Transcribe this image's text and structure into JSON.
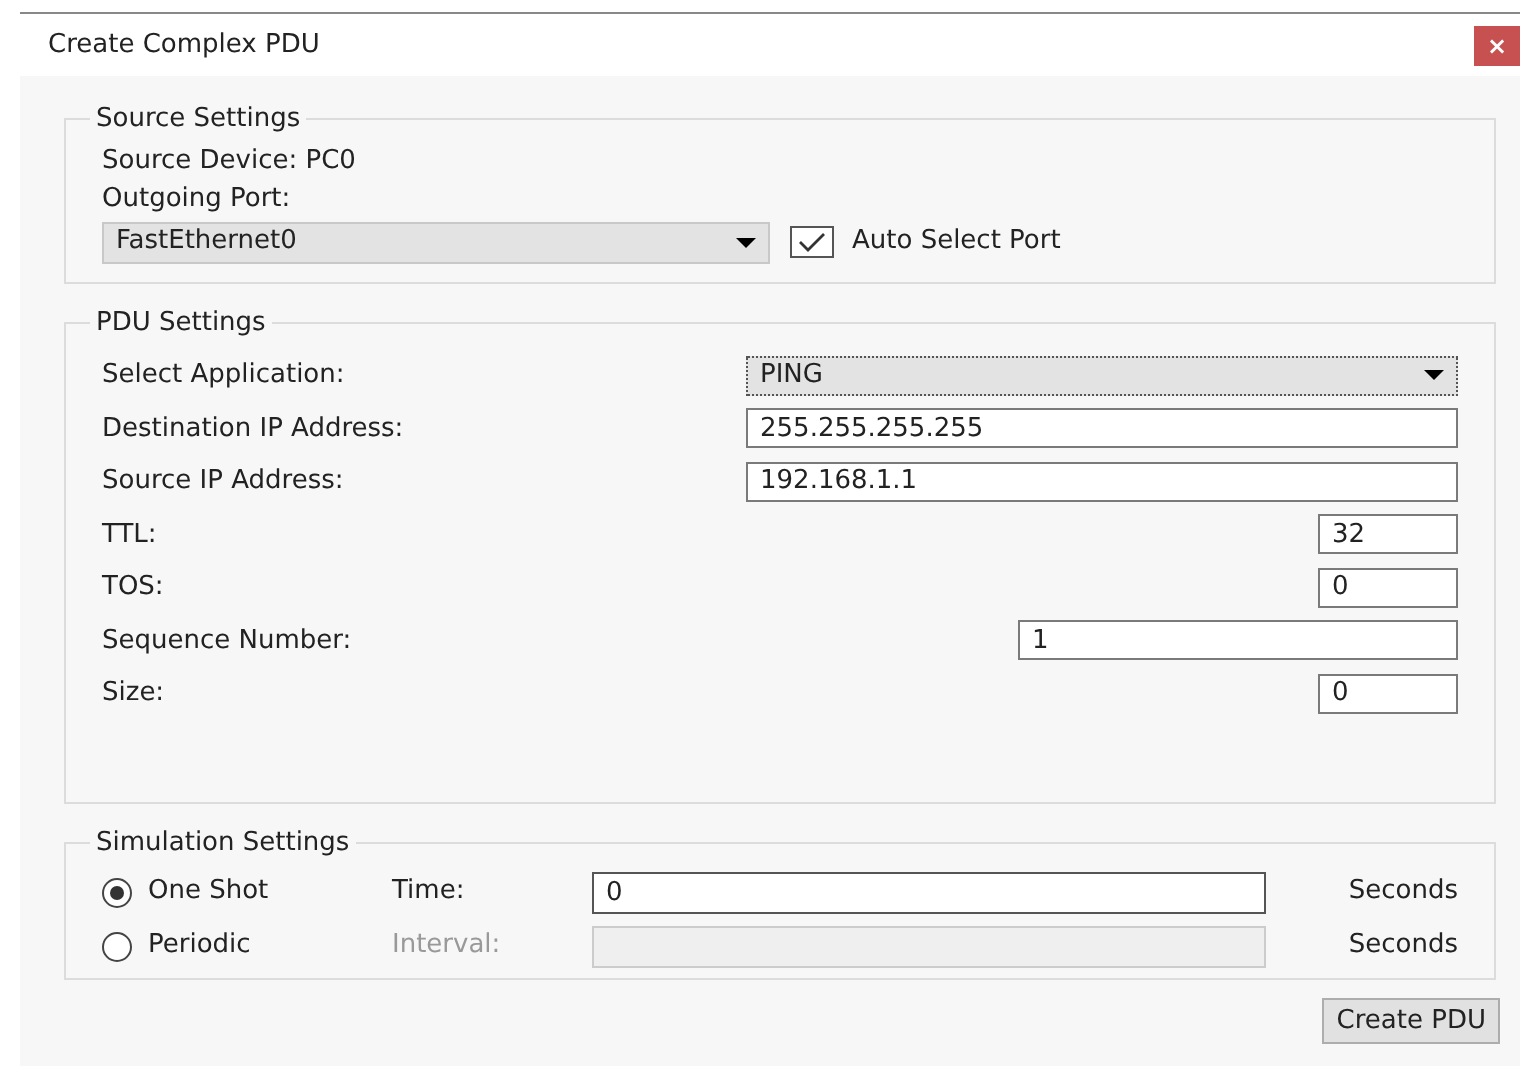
{
  "window": {
    "title": "Create Complex PDU",
    "close": "×"
  },
  "source_settings": {
    "title": "Source Settings",
    "device_label": "Source Device: PC0",
    "port_label": "Outgoing Port:",
    "port": "FastEthernet0",
    "auto_select": {
      "label": "Auto Select Port",
      "checked": true
    }
  },
  "pdu_settings": {
    "title": "PDU Settings",
    "fields": [
      {
        "kind": "dropdown",
        "label": "Select Application:",
        "value": "PING"
      },
      {
        "kind": "long",
        "label": "Destination IP Address:",
        "value": "255.255.255.255"
      },
      {
        "kind": "long",
        "label": "Source IP Address:",
        "value": "192.168.1.1"
      },
      {
        "kind": "short",
        "label": "TTL:",
        "value": "32"
      },
      {
        "kind": "short",
        "label": "TOS:",
        "value": "0"
      },
      {
        "kind": "medium",
        "label": "Sequence Number:",
        "value": "1"
      },
      {
        "kind": "short",
        "label": "Size:",
        "value": "0"
      }
    ]
  },
  "simulation_settings": {
    "title": "Simulation Settings",
    "modes": [
      {
        "label": "One Shot",
        "selected": true,
        "field_label": "Time:",
        "value": "0",
        "unit": "Seconds",
        "disabled": false
      },
      {
        "label": "Periodic",
        "selected": false,
        "field_label": "Interval:",
        "unit": "Seconds",
        "disabled": true
      }
    ]
  },
  "buttons": [
    "Create PDU"
  ]
}
